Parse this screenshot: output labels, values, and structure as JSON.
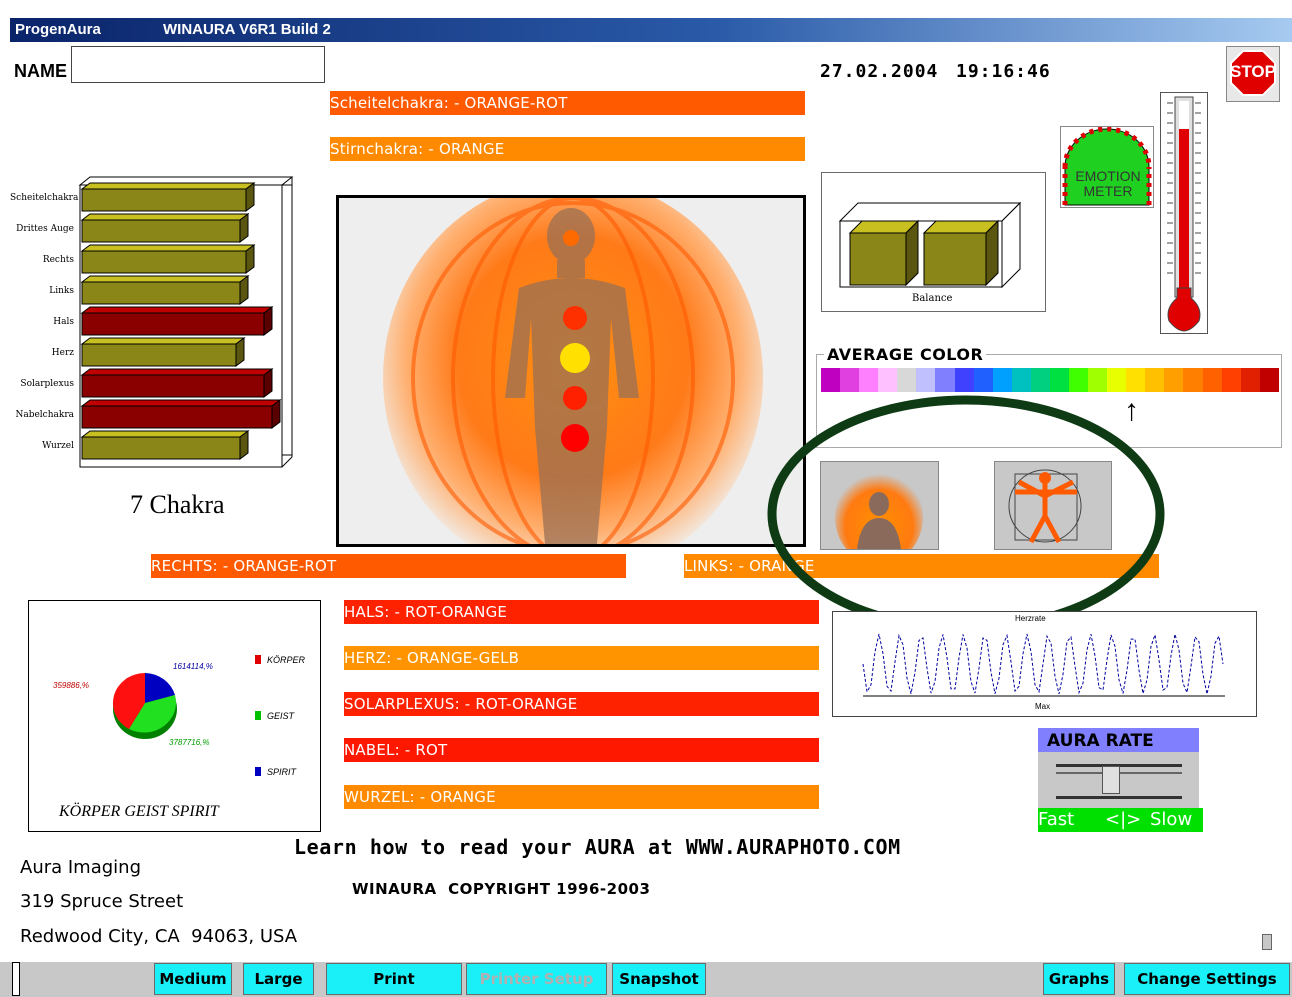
{
  "window": {
    "app_name": "ProgenAura",
    "title": "WINAURA V6R1 Build 2"
  },
  "header": {
    "name_label": "NAME",
    "name_value": "",
    "date": "27.02.2004",
    "time": "19:16:46"
  },
  "stop_button": {
    "label": "STOP"
  },
  "emotion_meter": {
    "label_line1": "EMOTION",
    "label_line2": "METER"
  },
  "chakra_bars": {
    "scheitel": "Scheitelchakra: - ORANGE-ROT",
    "stirn": "Stirnchakra: - ORANGE"
  },
  "chakra_chart": {
    "title": "7 Chakra",
    "labels": [
      "Scheitelchakra",
      "Drittes Auge",
      "Rechts",
      "Links",
      "Hals",
      "Herz",
      "Solarplexus",
      "Nabelchakra",
      "Wurzel"
    ]
  },
  "balance_chart": {
    "label": "Balance"
  },
  "average_color": {
    "title": "AVERAGE COLOR",
    "spectrum": [
      "#c000c0",
      "#e040e0",
      "#ff80ff",
      "#ffc0ff",
      "#d8d8d8",
      "#c0c0ff",
      "#8080ff",
      "#4040ff",
      "#2060ff",
      "#00a0ff",
      "#00c0c0",
      "#00d080",
      "#00e040",
      "#40ff00",
      "#a0ff00",
      "#e8ff00",
      "#ffe000",
      "#ffc000",
      "#ffa000",
      "#ff8000",
      "#ff6000",
      "#ff4000",
      "#e02000",
      "#c00000"
    ],
    "arrow": "↑"
  },
  "sides": {
    "rechts": "RECHTS: - ORANGE-ROT",
    "links": "LINKS: - ORANGE"
  },
  "pie_chart": {
    "title": "KÖRPER GEIST SPIRIT",
    "labels": {
      "red": "359886,%",
      "blue": "1614114,%",
      "green": "3787716,%"
    },
    "legend": [
      "KÖRPER",
      "GEIST",
      "SPIRIT"
    ]
  },
  "detail_bars": {
    "hals": "HALS: - ROT-ORANGE",
    "herz": "HERZ: - ORANGE-GELB",
    "solarplexus": "SOLARPLEXUS: - ROT-ORANGE",
    "nabel": "NABEL: - ROT",
    "wurzel": "WURZEL: - ORANGE"
  },
  "wave_chart": {
    "title": "Herzrate",
    "xlabel": "Max"
  },
  "aura_rate": {
    "title": "AURA RATE",
    "fast": "Fast",
    "mid": "<|>",
    "slow": "Slow"
  },
  "footer": {
    "learn": "Learn how to read your AURA at WWW.AURAPHOTO.COM",
    "copyright": "WINAURA  COPYRIGHT 1996-2003",
    "address1": "Aura Imaging",
    "address2": "319 Spruce Street",
    "address3": "Redwood City, CA  94063, USA"
  },
  "buttons": {
    "medium": "Medium",
    "large": "Large",
    "print": "Print",
    "printer_setup": "Printer Setup",
    "snapshot": "Snapshot",
    "graphs": "Graphs",
    "change_settings": "Change Settings"
  }
}
